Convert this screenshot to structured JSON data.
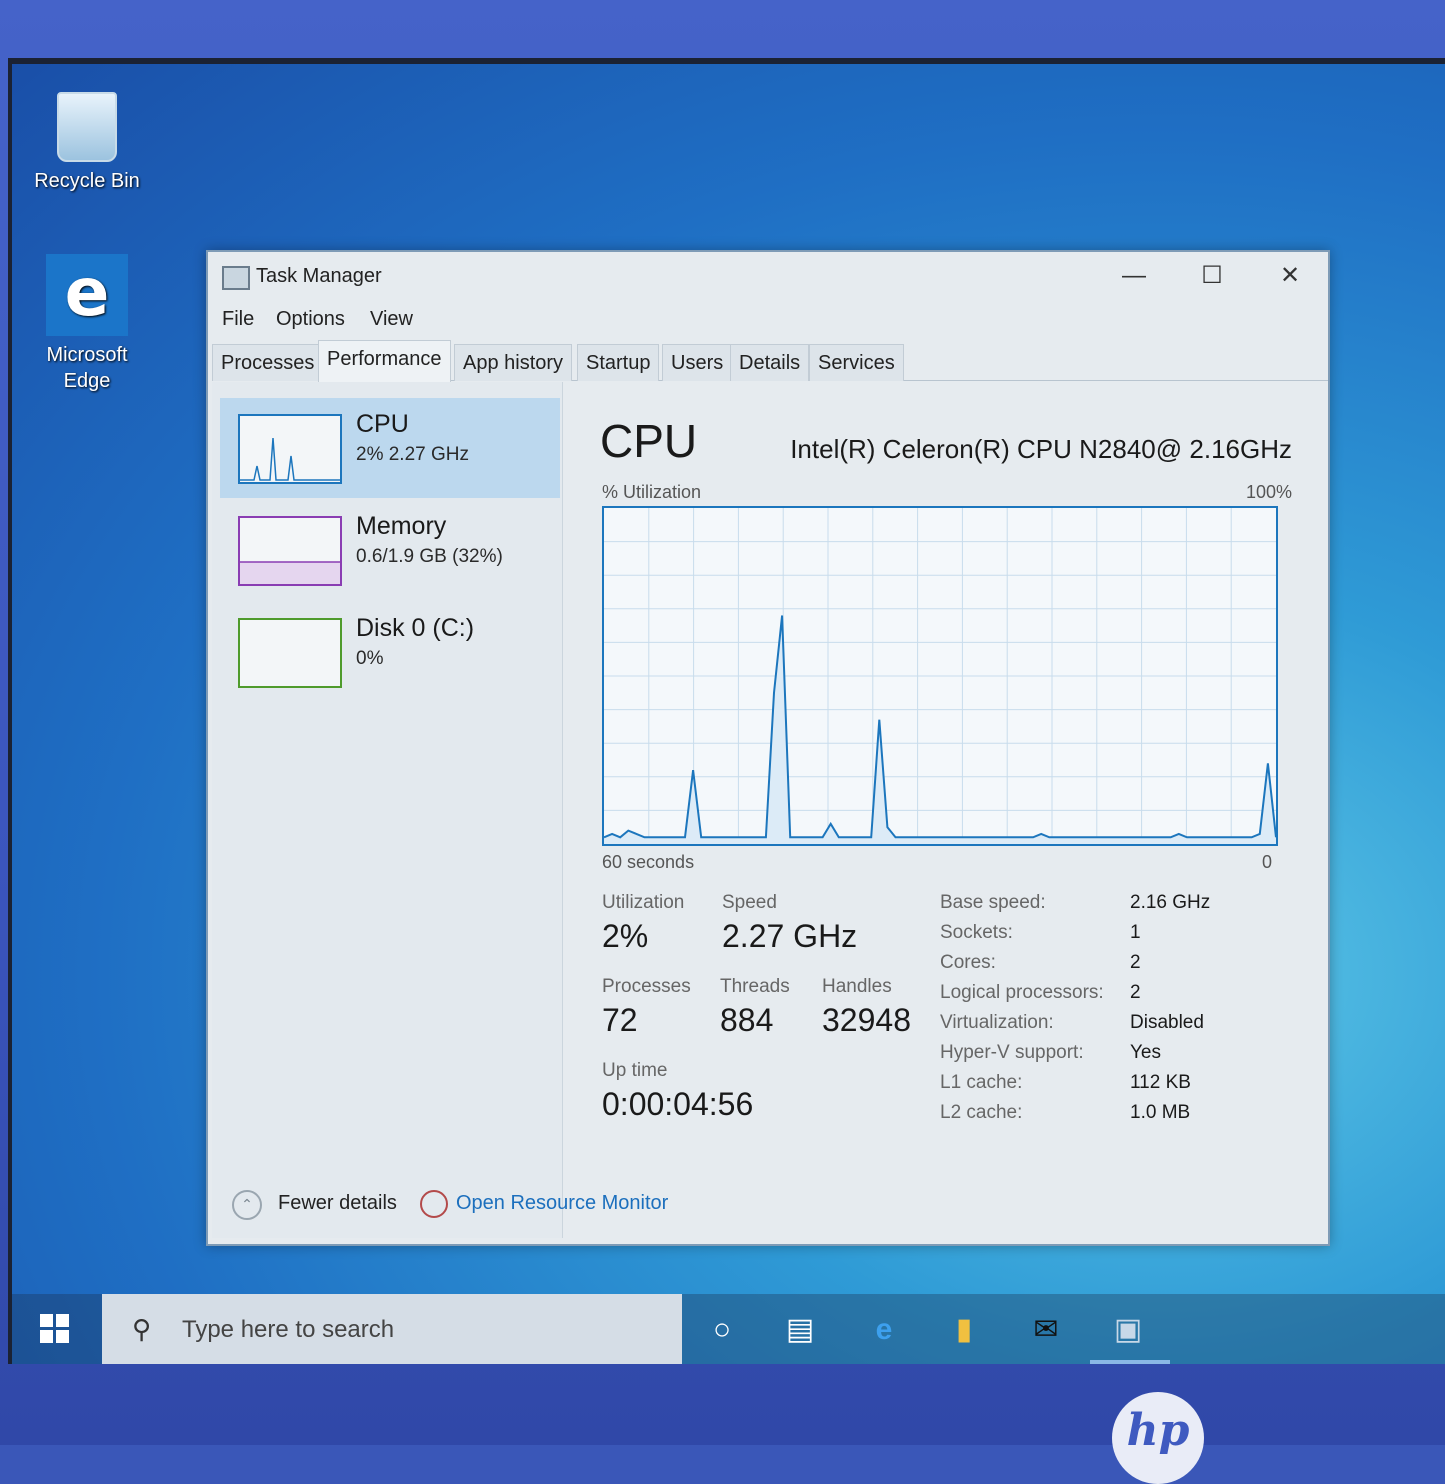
{
  "desktop": {
    "recycle_bin": "Recycle Bin",
    "edge_line1": "Microsoft",
    "edge_line2": "Edge"
  },
  "window": {
    "title": "Task Manager",
    "menu": [
      "File",
      "Options",
      "View"
    ],
    "tabs": [
      "Processes",
      "Performance",
      "App history",
      "Startup",
      "Users",
      "Details",
      "Services"
    ],
    "active_tab": "Performance"
  },
  "sidebar": {
    "items": [
      {
        "title": "CPU",
        "subtitle": "2% 2.27 GHz"
      },
      {
        "title": "Memory",
        "subtitle": "0.6/1.9 GB (32%)"
      },
      {
        "title": "Disk 0 (C:)",
        "subtitle": "0%"
      }
    ]
  },
  "cpu": {
    "heading": "CPU",
    "model": "Intel(R) Celeron(R) CPU N2840@ 2.16GHz",
    "graph_label": "% Utilization",
    "graph_max": "100%",
    "time_left": "60 seconds",
    "time_right": "0",
    "stats": {
      "utilization_label": "Utilization",
      "utilization": "2%",
      "speed_label": "Speed",
      "speed": "2.27 GHz",
      "processes_label": "Processes",
      "processes": "72",
      "threads_label": "Threads",
      "threads": "884",
      "handles_label": "Handles",
      "handles": "32948",
      "uptime_label": "Up time",
      "uptime": "0:00:04:56"
    },
    "specs": [
      {
        "key": "Base speed:",
        "value": "2.16 GHz"
      },
      {
        "key": "Sockets:",
        "value": "1"
      },
      {
        "key": "Cores:",
        "value": "2"
      },
      {
        "key": "Logical processors:",
        "value": "2"
      },
      {
        "key": "Virtualization:",
        "value": "Disabled"
      },
      {
        "key": "Hyper-V support:",
        "value": "Yes"
      },
      {
        "key": "L1 cache:",
        "value": "112 KB"
      },
      {
        "key": "L2 cache:",
        "value": "1.0 MB"
      }
    ],
    "utilization_history": [
      2,
      3,
      2,
      4,
      3,
      2,
      2,
      2,
      2,
      2,
      2,
      22,
      2,
      2,
      2,
      2,
      2,
      2,
      2,
      2,
      2,
      45,
      68,
      2,
      2,
      2,
      2,
      2,
      6,
      2,
      2,
      2,
      2,
      2,
      37,
      5,
      2,
      2,
      2,
      2,
      2,
      2,
      2,
      2,
      2,
      2,
      2,
      2,
      2,
      2,
      2,
      2,
      2,
      2,
      3,
      2,
      2,
      2,
      2,
      2,
      2,
      2,
      2,
      2,
      2,
      2,
      2,
      2,
      2,
      2,
      2,
      3,
      2,
      2,
      2,
      2,
      2,
      2,
      2,
      2,
      2,
      3,
      24,
      2
    ]
  },
  "footer": {
    "fewer_details": "Fewer details",
    "open_resource_monitor": "Open Resource Monitor"
  },
  "taskbar": {
    "search_placeholder": "Type here to search"
  },
  "brand": {
    "logo_text": "hp"
  },
  "colors": {
    "cpu_accent": "#1c76bd",
    "memory_accent": "#8a3db3",
    "disk_accent": "#4f9b2c"
  }
}
